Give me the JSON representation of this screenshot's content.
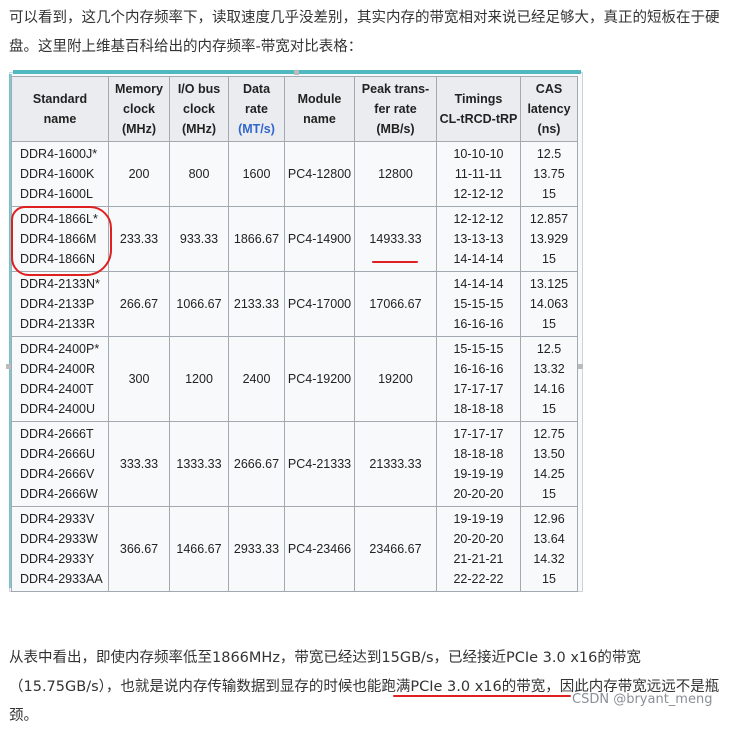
{
  "intro_text": "可以看到，这几个内存频率下，读取速度几乎没差别，其实内存的带宽相对来说已经足够大，真正的短板在于硬盘。这里附上维基百科给出的内存频率-带宽对比表格：",
  "table": {
    "headers": {
      "standard_name": [
        "Standard",
        "name"
      ],
      "memory_clock": [
        "Memory",
        "clock",
        "(MHz)"
      ],
      "io_bus_clock": [
        "I/O bus",
        "clock",
        "(MHz)"
      ],
      "data_rate": [
        "Data",
        "rate",
        "(MT/s)"
      ],
      "module_name": [
        "Module",
        "name"
      ],
      "peak_transfer_rate": [
        "Peak trans-",
        "fer rate",
        "(MB/s)"
      ],
      "timings": [
        "Timings",
        "CL-tRCD-tRP"
      ],
      "cas_latency": [
        "CAS",
        "latency",
        "(ns)"
      ]
    },
    "rows": [
      {
        "names": [
          "DDR4-1600J*",
          "DDR4-1600K",
          "DDR4-1600L"
        ],
        "mem": "200",
        "io": "800",
        "rate": "1600",
        "module": "PC4-12800",
        "peak": "12800",
        "timings": [
          "10-10-10",
          "11-11-11",
          "12-12-12"
        ],
        "cas": [
          "12.5",
          "13.75",
          "15"
        ]
      },
      {
        "names": [
          "DDR4-1866L*",
          "DDR4-1866M",
          "DDR4-1866N"
        ],
        "mem": "233.33",
        "io": "933.33",
        "rate": "1866.67",
        "module": "PC4-14900",
        "peak": "14933.33",
        "timings": [
          "12-12-12",
          "13-13-13",
          "14-14-14"
        ],
        "cas": [
          "12.857",
          "13.929",
          "15"
        ]
      },
      {
        "names": [
          "DDR4-2133N*",
          "DDR4-2133P",
          "DDR4-2133R"
        ],
        "mem": "266.67",
        "io": "1066.67",
        "rate": "2133.33",
        "module": "PC4-17000",
        "peak": "17066.67",
        "timings": [
          "14-14-14",
          "15-15-15",
          "16-16-16"
        ],
        "cas": [
          "13.125",
          "14.063",
          "15"
        ]
      },
      {
        "names": [
          "DDR4-2400P*",
          "DDR4-2400R",
          "DDR4-2400T",
          "DDR4-2400U"
        ],
        "mem": "300",
        "io": "1200",
        "rate": "2400",
        "module": "PC4-19200",
        "peak": "19200",
        "timings": [
          "15-15-15",
          "16-16-16",
          "17-17-17",
          "18-18-18"
        ],
        "cas": [
          "12.5",
          "13.32",
          "14.16",
          "15"
        ]
      },
      {
        "names": [
          "DDR4-2666T",
          "DDR4-2666U",
          "DDR4-2666V",
          "DDR4-2666W"
        ],
        "mem": "333.33",
        "io": "1333.33",
        "rate": "2666.67",
        "module": "PC4-21333",
        "peak": "21333.33",
        "timings": [
          "17-17-17",
          "18-18-18",
          "19-19-19",
          "20-20-20"
        ],
        "cas": [
          "12.75",
          "13.50",
          "14.25",
          "15"
        ]
      },
      {
        "names": [
          "DDR4-2933V",
          "DDR4-2933W",
          "DDR4-2933Y",
          "DDR4-2933AA"
        ],
        "mem": "366.67",
        "io": "1466.67",
        "rate": "2933.33",
        "module": "PC4-23466",
        "peak": "23466.67",
        "timings": [
          "19-19-19",
          "20-20-20",
          "21-21-21",
          "22-22-22"
        ],
        "cas": [
          "12.96",
          "13.64",
          "14.32",
          "15"
        ]
      }
    ]
  },
  "outro_text": {
    "part1": "从表中看出，即使内存频率低至1866MHz，带宽已经达到15GB/s，已经接近PCIe 3.0 x16的带宽（15.75GB/s），也就是说内存传输数据到显存的时候也能跑满PCIe 3.0 x16的带宽，",
    "emphasis": "因此内存带宽远远不是瓶颈。"
  },
  "watermark": "CSDN @bryant_meng",
  "colors": {
    "annotation_red": "#e02020",
    "frame_teal": "#4fb8c0",
    "header_bg": "#eaecf0",
    "link_blue": "#3366cc"
  }
}
